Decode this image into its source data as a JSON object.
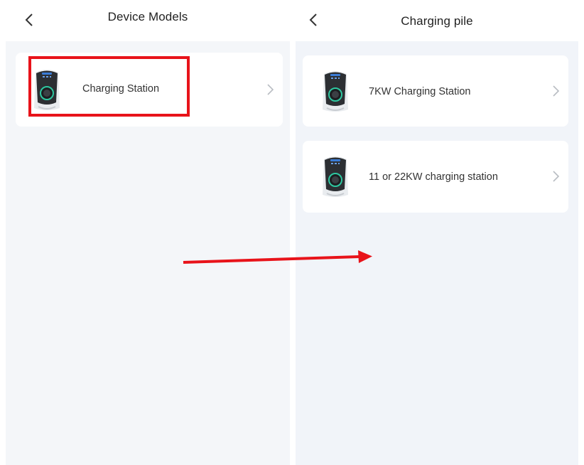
{
  "left_screen": {
    "title": "Device Models",
    "items": [
      {
        "label": "Charging Station",
        "icon": "ev-charger-image",
        "chevron": "chevron-right-icon",
        "highlighted": true
      }
    ]
  },
  "right_screen": {
    "title": "Charging pile",
    "items": [
      {
        "label": "7KW Charging Station",
        "icon": "ev-charger-image",
        "chevron": "chevron-right-icon"
      },
      {
        "label": "11 or 22KW charging station",
        "icon": "ev-charger-image",
        "chevron": "chevron-right-icon"
      }
    ]
  },
  "annotations": {
    "highlight_color": "#e8131a",
    "arrow_color": "#e8131a",
    "arrow_direction": "right"
  },
  "colors": {
    "page_background": "#f4f6f9",
    "card_background": "#ffffff",
    "charger_ring": "#2ec7a0"
  }
}
